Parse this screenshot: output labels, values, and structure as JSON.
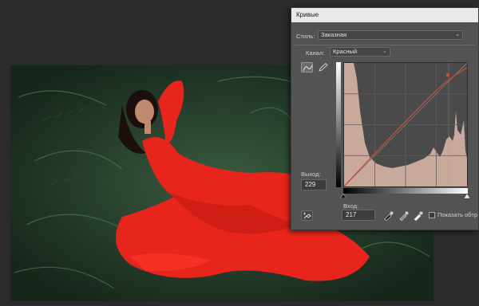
{
  "dialog": {
    "title": "Кривые",
    "style_label": "Стиль:",
    "style_value": "Заказная",
    "channel_label": "Канал:",
    "channel_value": "Красный",
    "output_label": "Выход:",
    "output_value": "229",
    "input_label": "Вход:",
    "input_value": "217",
    "show_clipping_label": "Показать обтр",
    "show_clipping_checked": false
  },
  "icons": {
    "curve_tool": "curve-points-icon",
    "pencil_tool": "pencil-icon",
    "auto_target": "on-image-adjust-icon",
    "black_eyedropper": "black-point-eyedropper-icon",
    "gray_eyedropper": "gray-point-eyedropper-icon",
    "white_eyedropper": "white-point-eyedropper-icon"
  },
  "colors": {
    "curve_line": "#c84b3a",
    "histogram_fill": "#c9a99c",
    "dialog_bg": "#535353",
    "workspace_bg": "#2b2b2b",
    "dress_red": "#e8251c"
  }
}
